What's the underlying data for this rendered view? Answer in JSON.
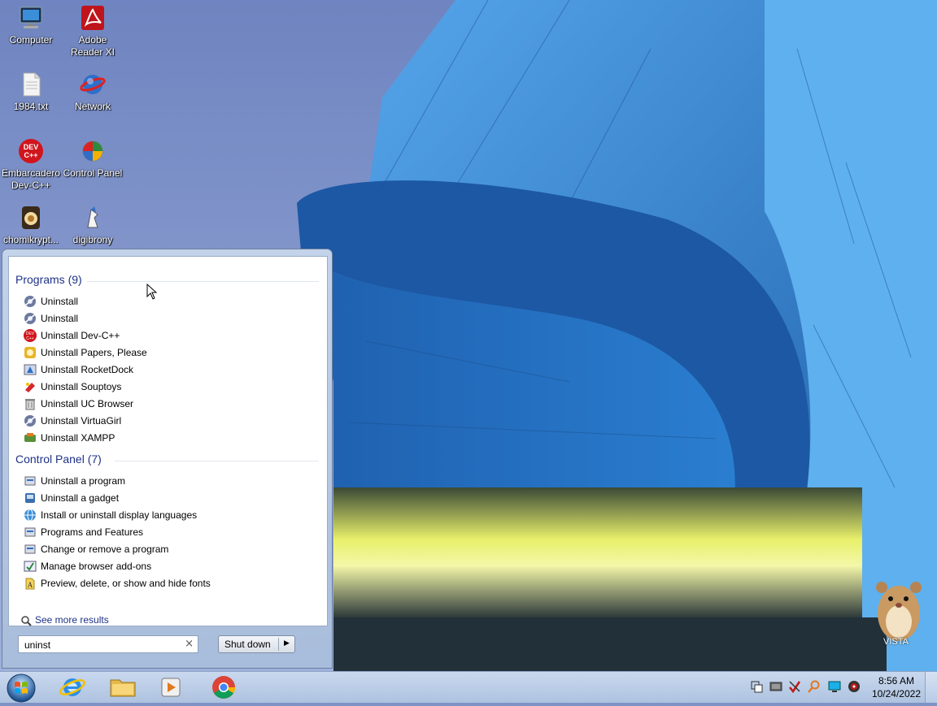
{
  "desktop": {
    "icons": [
      {
        "label": "Computer",
        "icon": "computer-icon"
      },
      {
        "label": "Adobe Reader XI",
        "icon": "adobe-reader-icon"
      },
      {
        "label": "1984.txt",
        "icon": "text-file-icon"
      },
      {
        "label": "Network",
        "icon": "network-icon"
      },
      {
        "label": "Embarcadero Dev-C++",
        "icon": "devcpp-icon",
        "glyph_text": "DEV C++"
      },
      {
        "label": "Control Panel",
        "icon": "control-panel-icon"
      },
      {
        "label": "chomikrypt...",
        "icon": "chomikrypt-icon"
      },
      {
        "label": "digibrony",
        "icon": "digibrony-icon"
      }
    ],
    "watermark": "VISTA"
  },
  "start_menu": {
    "programs_header": "Programs (9)",
    "programs": [
      {
        "label": "Uninstall",
        "icon": "uninstall-generic-icon"
      },
      {
        "label": "Uninstall",
        "icon": "uninstall-generic-icon"
      },
      {
        "label": "Uninstall Dev-C++",
        "icon": "devcpp-icon"
      },
      {
        "label": "Uninstall Papers, Please",
        "icon": "papers-please-icon"
      },
      {
        "label": "Uninstall RocketDock",
        "icon": "rocketdock-icon"
      },
      {
        "label": "Uninstall Souptoys",
        "icon": "souptoys-icon"
      },
      {
        "label": "Uninstall UC Browser",
        "icon": "trash-icon"
      },
      {
        "label": "Uninstall VirtuaGirl",
        "icon": "uninstall-generic-icon"
      },
      {
        "label": "Uninstall XAMPP",
        "icon": "xampp-icon"
      }
    ],
    "control_panel_header": "Control Panel (7)",
    "control_panel": [
      {
        "label": "Uninstall a program",
        "icon": "programs-icon"
      },
      {
        "label": "Uninstall a gadget",
        "icon": "gadget-icon"
      },
      {
        "label": "Install or uninstall display languages",
        "icon": "globe-icon"
      },
      {
        "label": "Programs and Features",
        "icon": "programs-icon"
      },
      {
        "label": "Change or remove a program",
        "icon": "programs-icon"
      },
      {
        "label": "Manage browser add-ons",
        "icon": "addons-icon"
      },
      {
        "label": "Preview, delete, or show and hide fonts",
        "icon": "fonts-icon"
      }
    ],
    "see_more": "See more results",
    "search_value": "uninst",
    "search_clear": "×",
    "shutdown_label": "Shut down",
    "shutdown_arrow": "▶"
  },
  "taskbar": {
    "pinned": [
      {
        "name": "internet-explorer",
        "icon": "ie-icon"
      },
      {
        "name": "file-explorer",
        "icon": "folder-icon"
      },
      {
        "name": "media-player",
        "icon": "media-player-icon"
      },
      {
        "name": "chrome",
        "icon": "chrome-icon"
      }
    ],
    "clock_time": "8:56 AM",
    "clock_date": "10/24/2022"
  },
  "colors": {
    "group_header": "#1e3287",
    "taskbar": "#bcd0ea",
    "wallpaper_sky": "#8d9fd0",
    "building_blue": "#2d7ac8"
  }
}
